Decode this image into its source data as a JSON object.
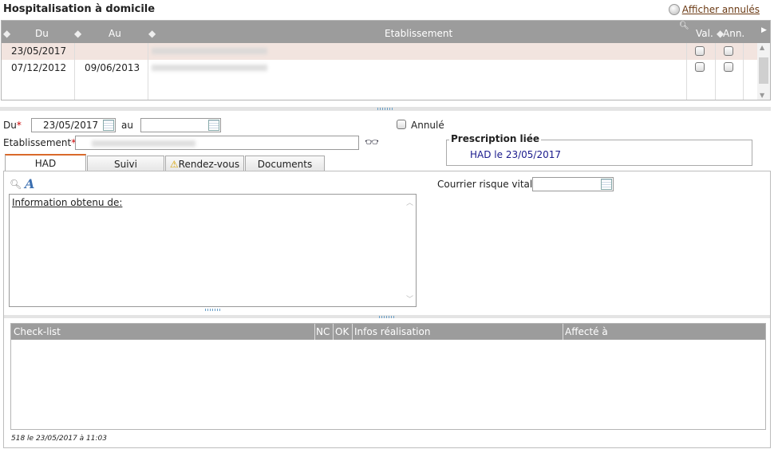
{
  "header": {
    "title": "Hospitalisation à domicile",
    "show_cancelled": "Afficher annulés"
  },
  "grid": {
    "columns": [
      "Du",
      "Au",
      "Etablissement",
      "Val.",
      "Ann."
    ],
    "rows": [
      {
        "du": "23/05/2017",
        "au": "",
        "selected": true
      },
      {
        "du": "07/12/2012",
        "au": "09/06/2013",
        "selected": false
      }
    ]
  },
  "form": {
    "du_label": "Du",
    "required_mark": "*",
    "du_value": "23/05/2017",
    "au_label": "au",
    "au_value": "",
    "annule_label": "Annulé",
    "etab_label": "Etablissement",
    "prescription_title": "Prescription liée",
    "prescription_link": "HAD le 23/05/2017"
  },
  "tabs": [
    "HAD",
    "Suivi",
    "Rendez-vous",
    "Documents"
  ],
  "had": {
    "info_text": "Information obtenu de:",
    "courrier_label": "Courrier risque vital",
    "courrier_value": ""
  },
  "checklist": {
    "columns": [
      "Check-list",
      "NC",
      "OK",
      "Infos réalisation",
      "Affecté à"
    ]
  },
  "footer": {
    "status": "518 le 23/05/2017 à 11:03"
  },
  "colors": {
    "header_gray": "#9c9c9c",
    "selected_row": "#f2e4df",
    "active_tab_accent": "#d9692a",
    "required": "#cc0000",
    "link": "#1a1a8c"
  }
}
